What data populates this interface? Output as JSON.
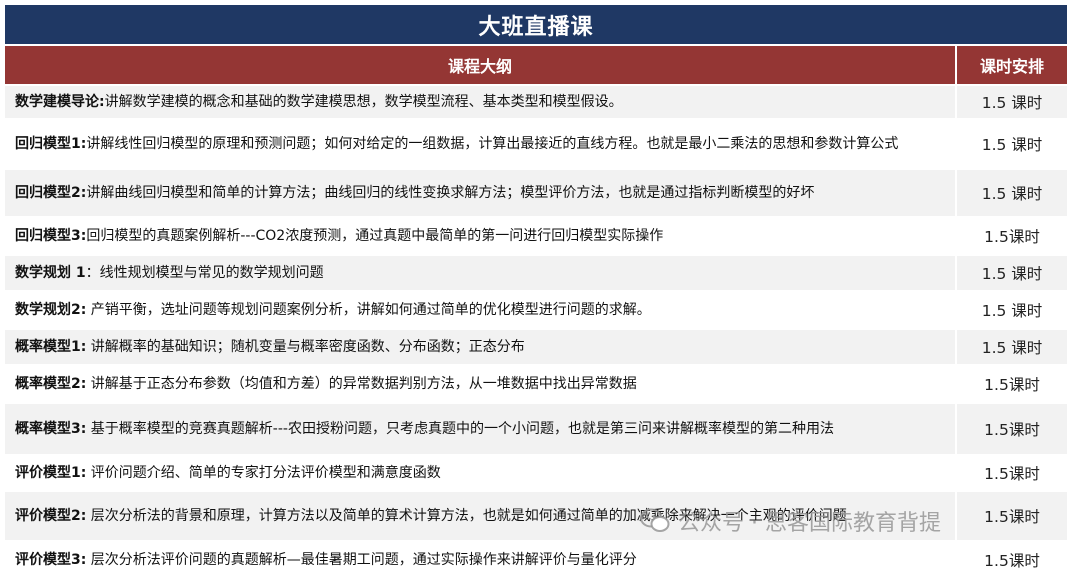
{
  "title": "大班直播课",
  "header": {
    "outline": "课程大纲",
    "hours": "课时安排"
  },
  "rows": [
    {
      "label": "数学建模导论:",
      "desc": "讲解数学建模的概念和基础的数学建模思想，数学模型流程、基本类型和模型假设。",
      "hours": "1.5 课时"
    },
    {
      "label": "回归模型1:",
      "desc": "讲解线性回归模型的原理和预测问题；如何对给定的一组数据，计算出最接近的直线方程。也就是最小二乘法的思想和参数计算公式",
      "hours": "1.5 课时"
    },
    {
      "label": "回归模型2:",
      "desc": "讲解曲线回归模型和简单的计算方法；曲线回归的线性变换求解方法；模型评价方法，也就是通过指标判断模型的好坏",
      "hours": "1.5 课时"
    },
    {
      "label": "回归模型3:",
      "desc": "回归模型的真题案例解析---CO2浓度预测，通过真题中最简单的第一问进行回归模型实际操作",
      "hours": "1.5课时"
    },
    {
      "label": "数学规划 1",
      "desc": "：线性规划模型与常见的数学规划问题",
      "hours": "1.5 课时"
    },
    {
      "label": "数学规划2:",
      "desc": " 产销平衡，选址问题等规划问题案例分析，讲解如何通过简单的优化模型进行问题的求解。",
      "hours": "1.5 课时"
    },
    {
      "label": "概率模型1:",
      "desc": " 讲解概率的基础知识；随机变量与概率密度函数、分布函数；正态分布",
      "hours": "1.5 课时"
    },
    {
      "label": "概率模型2:",
      "desc": " 讲解基于正态分布参数（均值和方差）的异常数据判别方法，从一堆数据中找出异常数据",
      "hours": "1.5课时"
    },
    {
      "label": "概率模型3:",
      "desc": " 基于概率模型的竞赛真题解析---农田授粉问题，只考虑真题中的一个小问题，也就是第三问来讲解概率模型的第二种用法",
      "hours": "1.5课时"
    },
    {
      "label": "评价模型1:",
      "desc": " 评价问题介绍、简单的专家打分法评价模型和满意度函数",
      "hours": "1.5课时"
    },
    {
      "label": "评价模型2:",
      "desc": " 层次分析法的背景和原理，计算方法以及简单的算术计算方法，也就是如何通过简单的加减乘除来解决一个主观的评价问题",
      "hours": "1.5课时"
    },
    {
      "label": "评价模型3:",
      "desc": " 层次分析法评价问题的真题解析—最佳暑期工问题，通过实际操作来讲解评价与量化评分",
      "hours": "1.5课时"
    }
  ],
  "watermark": "公众号 · 思客国际教育背提",
  "colors": {
    "title_bg": "#1f3864",
    "header_bg": "#943634",
    "stripe": "#f2f2f2"
  }
}
